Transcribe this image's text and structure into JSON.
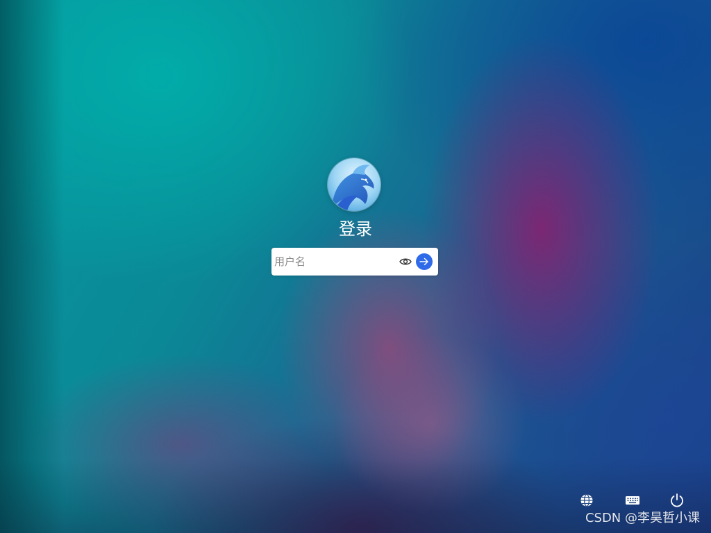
{
  "login": {
    "title": "登录",
    "username_placeholder": "用户名",
    "username_value": ""
  },
  "icons": {
    "avatar": "dragon-avatar",
    "password_toggle": "eye-icon",
    "submit": "arrow-right-icon",
    "language": "globe-icon",
    "keyboard": "keyboard-icon",
    "power": "power-icon"
  },
  "colors": {
    "submit_button": "#2f6be8",
    "input_background": "#ffffff",
    "title_text": "#ffffff"
  },
  "watermark": {
    "text": "CSDN @李昊哲小课"
  }
}
